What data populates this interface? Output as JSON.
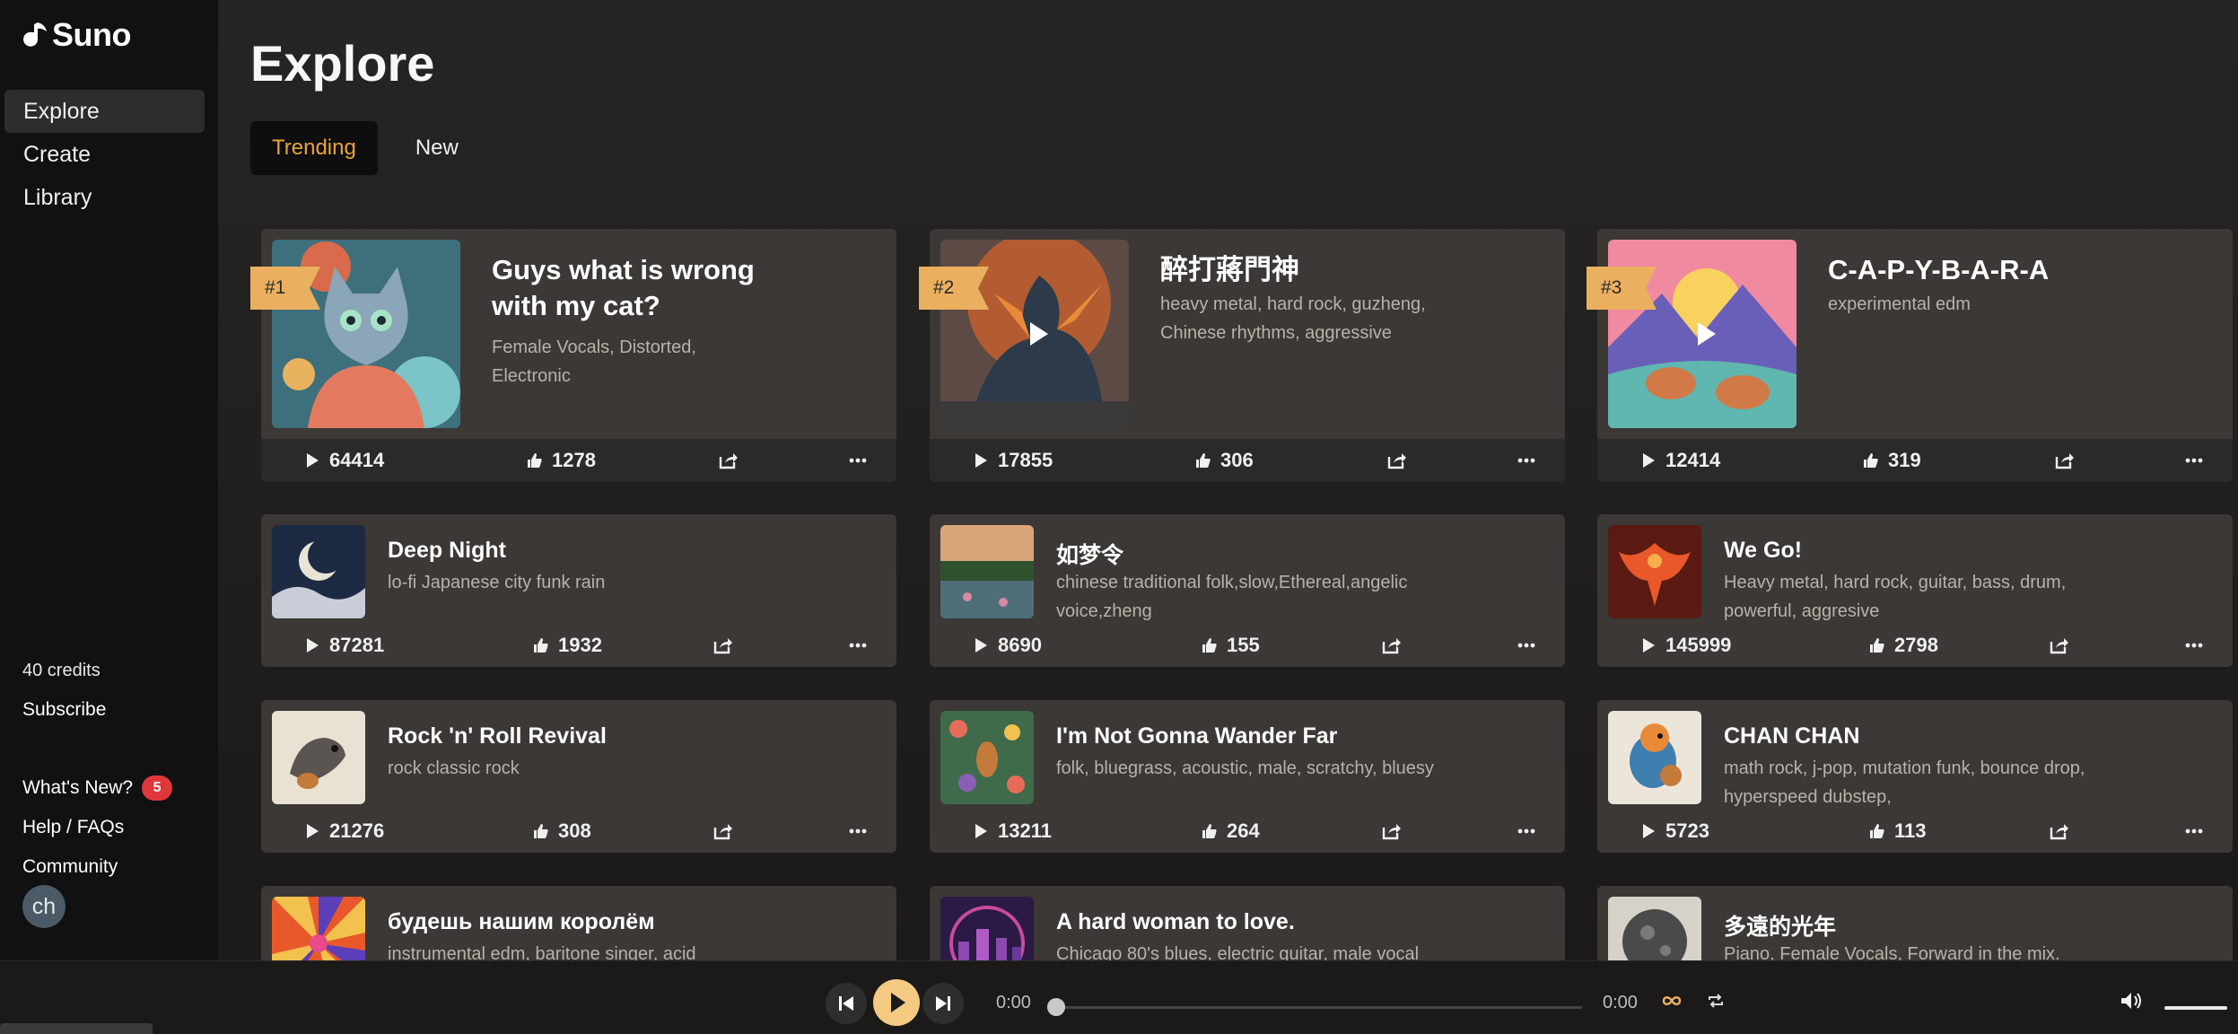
{
  "app": {
    "name": "Suno"
  },
  "sidebar": {
    "nav": [
      {
        "label": "Explore",
        "active": true
      },
      {
        "label": "Create"
      },
      {
        "label": "Library"
      }
    ],
    "credits": "40 credits",
    "subscribe": "Subscribe",
    "whats_new": "What's New?",
    "whats_new_count": "5",
    "help": "Help / FAQs",
    "community": "Community",
    "avatar": "ch"
  },
  "main": {
    "title": "Explore",
    "tabs": [
      {
        "label": "Trending",
        "active": true
      },
      {
        "label": "New"
      }
    ]
  },
  "featured": [
    {
      "rank": "#1",
      "title_line1": "Guys what is wrong",
      "title_line2": "with my cat?",
      "tags_line1": "Female Vocals, Distorted,",
      "tags_line2": "Electronic",
      "plays": "64414",
      "likes": "1278",
      "art": "cat-artwork"
    },
    {
      "rank": "#2",
      "title_line1": "醉打蔣門神",
      "title_line2": "",
      "tags_line1": "heavy metal, hard rock, guzheng,",
      "tags_line2": "Chinese rhythms, aggressive",
      "plays": "17855",
      "likes": "306",
      "art": "dragon-artwork"
    },
    {
      "rank": "#3",
      "title_line1": "C-A-P-Y-B-A-R-A",
      "title_line2": "",
      "tags_line1": "experimental edm",
      "tags_line2": "",
      "plays": "12414",
      "likes": "319",
      "art": "capybara-artwork"
    }
  ],
  "songs": [
    {
      "title": "Deep Night",
      "tags_line1": "lo-fi Japanese city funk rain",
      "tags_line2": "",
      "plays": "87281",
      "likes": "1932",
      "art": "moon-artwork"
    },
    {
      "title": "如梦令",
      "tags_line1": "chinese traditional folk,slow,Ethereal,angelic",
      "tags_line2": "voice,zheng",
      "plays": "8690",
      "likes": "155",
      "art": "lake-artwork"
    },
    {
      "title": "We Go!",
      "tags_line1": "Heavy metal, hard rock, guitar, bass, drum,",
      "tags_line2": "powerful, aggresive",
      "plays": "145999",
      "likes": "2798",
      "art": "phoenix-artwork"
    },
    {
      "title": "Rock 'n' Roll Revival",
      "tags_line1": "rock classic rock",
      "tags_line2": "",
      "plays": "21276",
      "likes": "308",
      "art": "bird-guitar-artwork"
    },
    {
      "title": "I'm Not Gonna Wander Far",
      "tags_line1": "folk, bluegrass, acoustic, male, scratchy, bluesy",
      "tags_line2": "",
      "plays": "13211",
      "likes": "264",
      "art": "floral-artwork"
    },
    {
      "title": "CHAN CHAN",
      "tags_line1": "math rock, j-pop, mutation funk, bounce drop,",
      "tags_line2": "hyperspeed dubstep,",
      "plays": "5723",
      "likes": "113",
      "art": "bird-banjo-artwork"
    },
    {
      "title": "будешь нашим королём",
      "tags_line1": "instrumental edm, baritone singer, acid",
      "tags_line2": "",
      "plays": "",
      "likes": "",
      "art": "burst-artwork"
    },
    {
      "title": "A hard woman to love.",
      "tags_line1": "Chicago 80's blues, electric guitar, male vocal",
      "tags_line2": "",
      "plays": "",
      "likes": "",
      "art": "city-artwork"
    },
    {
      "title": "多遠的光年",
      "tags_line1": "Piano, Female Vocals, Forward in the mix.",
      "tags_line2": "",
      "plays": "",
      "likes": "",
      "art": "planet-artwork"
    }
  ],
  "player": {
    "current": "0:00",
    "total": "0:00",
    "progress": 0
  },
  "colors": {
    "accent": "#eab060",
    "tab_active": "#e9a33f",
    "card": "#3b3835",
    "badge": "#e0373a"
  }
}
